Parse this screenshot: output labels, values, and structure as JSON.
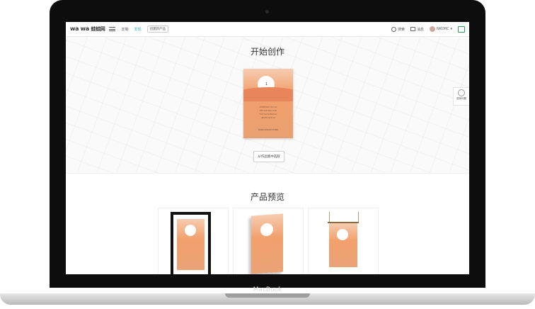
{
  "device": {
    "brand_label": "MacBook"
  },
  "nav": {
    "logo_latin": "wa wa",
    "logo_cn": "蛙蛙网",
    "links": [
      "定制",
      "发现"
    ],
    "create_button": "创建新产品",
    "search": "搜索",
    "messages": "消息",
    "username": "NKOHC ▾"
  },
  "hero": {
    "title": "开始创作",
    "select_button": "从作品集中选取",
    "poster": {
      "number": "1",
      "lines": [
        "WHEREVER YOU GO",
        "THE SUN WILL RISE",
        "FOR YOU EVERYDAY",
        "NEVER GIVE UP"
      ],
      "caption": "WAWA DESIGN STUDIO"
    }
  },
  "float_widget": {
    "label": "虚拟问题"
  },
  "preview": {
    "title": "产品预览"
  },
  "colors": {
    "accent": "#33b4c0",
    "poster_top": "#f6ccb0",
    "poster_bottom": "#e9a070"
  }
}
